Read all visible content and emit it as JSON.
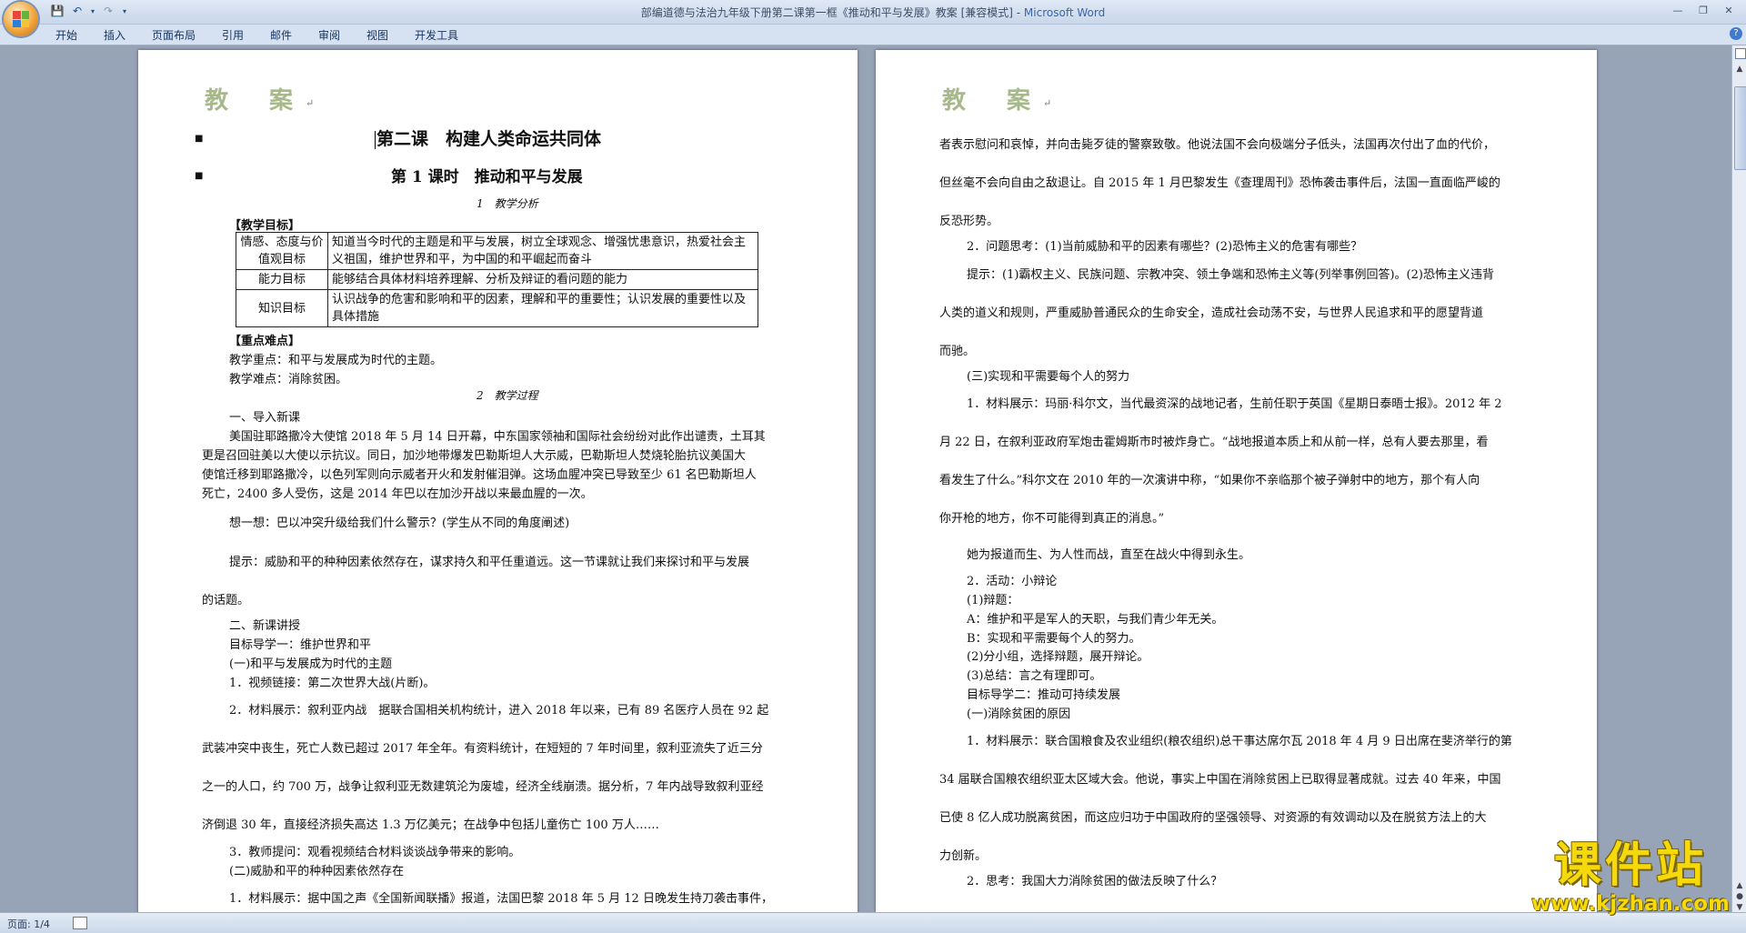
{
  "window": {
    "title": "部编道德与法治九年级下册第二课第一框《推动和平与发展》教案 [兼容模式] - ",
    "app_name": "Microsoft Word"
  },
  "ribbon_tabs": [
    "开始",
    "插入",
    "页面布局",
    "引用",
    "邮件",
    "审阅",
    "视图",
    "开发工具"
  ],
  "status": {
    "page": "页面: 1/4"
  },
  "watermark": {
    "brand": "课件站",
    "url": "www.kjzhan.com"
  },
  "page1": {
    "header": "教 案",
    "lesson_title": "第二课　构建人类命运共同体",
    "period_title": "第 1 课时　推动和平与发展",
    "sec1": "1　教学分析",
    "goals_label": "【教学目标】",
    "goals": [
      {
        "key": "情感、态度与价值观目标",
        "value": "知道当今时代的主题是和平与发展，树立全球观念、增强忧患意识，热爱社会主义祖国，维护世界和平，为中国的和平崛起而奋斗"
      },
      {
        "key": "能力目标",
        "value": "能够结合具体材料培养理解、分析及辩证的看问题的能力"
      },
      {
        "key": "知识目标",
        "value": "认识战争的危害和影响和平的因素，理解和平的重要性；认识发展的重要性以及具体措施"
      }
    ],
    "keypoints_label": "【重点难点】",
    "key_point": "教学重点：和平与发展成为时代的主题。",
    "difficulty": "教学难点：消除贫困。",
    "sec2": "2　教学过程",
    "lines": [
      "一、导入新课",
      "美国驻耶路撒冷大使馆 2018 年 5 月 14 日开幕，中东国家领袖和国际社会纷纷对此作出谴责，土耳其",
      "更是召回驻美以大使以示抗议。同日，加沙地带爆发巴勒斯坦人大示威，巴勒斯坦人焚烧轮胎抗议美国大",
      "使馆迁移到耶路撒冷，以色列军则向示威者开火和发射催泪弹。这场血腥冲突已导致至少 61 名巴勒斯坦人",
      "死亡，2400 多人受伤，这是 2014 年巴以在加沙开战以来最血腥的一次。",
      "想一想：巴以冲突升级给我们什么警示？(学生从不同的角度阐述)",
      "提示：威胁和平的种种因素依然存在，谋求持久和平任重道远。这一节课就让我们来探讨和平与发展",
      "的话题。",
      "二、新课讲授",
      "目标导学一：维护世界和平",
      "(一)和平与发展成为时代的主题",
      "1．视频链接：第二次世界大战(片断)。",
      "2．材料展示：叙利亚内战　据联合国相关机构统计，进入 2018 年以来，已有 89 名医疗人员在 92 起",
      "武装冲突中丧生，死亡人数已超过 2017 年全年。有资料统计，在短短的 7 年时间里，叙利亚流失了近三分",
      "之一的人口，约 700 万，战争让叙利亚无数建筑沦为废墟，经济全线崩溃。据分析，7 年内战导致叙利亚经",
      "济倒退 30 年，直接经济损失高达 1.3 万亿美元；在战争中包括儿童伤亡 100 万人……",
      "3．教师提问：观看视频结合材料谈谈战争带来的影响。",
      "(二)威胁和平的种种因素依然存在",
      "1．材料展示：据中国之声《全国新闻联播》报道，法国巴黎 2018 年 5 月 12 日晚发生持刀袭击事件，"
    ]
  },
  "page2": {
    "header": "教 案",
    "lines": [
      "者表示慰问和哀悼，并向击毙歹徒的警察致敬。他说法国不会向极端分子低头，法国再次付出了血的代价，",
      "但丝毫不会向自由之敌退让。自 2015 年 1 月巴黎发生《查理周刊》恐怖袭击事件后，法国一直面临严峻的",
      "反恐形势。",
      "2．问题思考：(1)当前威胁和平的因素有哪些？(2)恐怖主义的危害有哪些？",
      "提示：(1)霸权主义、民族问题、宗教冲突、领土争端和恐怖主义等(列举事例回答)。(2)恐怖主义违背",
      "人类的道义和规则，严重威胁普通民众的生命安全，造成社会动荡不安，与世界人民追求和平的愿望背道",
      "而驰。",
      "(三)实现和平需要每个人的努力",
      "1．材料展示：玛丽·科尔文，当代最资深的战地记者，生前任职于英国《星期日泰晤士报》。2012 年 2",
      "月 22 日，在叙利亚政府军炮击霍姆斯市时被炸身亡。“战地报道本质上和从前一样，总有人要去那里，看",
      "看发生了什么。”科尔文在 2010 年的一次演讲中称，“如果你不亲临那个被子弹射中的地方，那个有人向",
      "你开枪的地方，你不可能得到真正的消息。”",
      "她为报道而生、为人性而战，直至在战火中得到永生。",
      "2．活动：小辩论",
      "(1)辩题：",
      "A：维护和平是军人的天职，与我们青少年无关。",
      "B：实现和平需要每个人的努力。",
      "(2)分小组，选择辩题，展开辩论。",
      "(3)总结：言之有理即可。",
      "目标导学二：推动可持续发展",
      "(一)消除贫困的原因",
      "1．材料展示：联合国粮食及农业组织(粮农组织)总干事达席尔瓦 2018 年 4 月 9 日出席在斐济举行的第",
      "34 届联合国粮农组织亚太区域大会。他说，事实上中国在消除贫困上已取得显著成就。过去 40 年来，中国",
      "已使 8 亿人成功脱离贫困，而这应归功于中国政府的坚强领导、对资源的有效调动以及在脱贫方法上的大",
      "力创新。",
      "2．思考：我国大力消除贫困的做法反映了什么？"
    ]
  }
}
